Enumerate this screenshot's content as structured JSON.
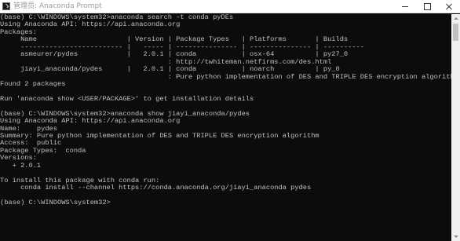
{
  "window": {
    "title": "管理员: Anaconda Prompt",
    "controls": {
      "minimize": "minimize",
      "maximize": "maximize",
      "close": "close"
    }
  },
  "console": {
    "lines": [
      "(base) C:\\WINDOWS\\system32>anaconda search -t conda pyDEs",
      "Using Anaconda API: https://api.anaconda.org",
      "Packages:",
      "     Name                      | Version | Package Types   | Platforms       | Builds",
      "     ------------------------- |   ----- | --------------- | --------------- | ----------",
      "     asmeurer/pydes            |   2.0.1 | conda           | osx-64          | py27_0",
      "                                         : http://twhiteman.netfirms.com/des.html",
      "     jiayi_anaconda/pydes      |   2.0.1 | conda           | noarch          | py_0",
      "                                         : Pure python implementation of DES and TRIPLE DES encryption algorithm",
      "Found 2 packages",
      "",
      "Run 'anaconda show <USER/PACKAGE>' to get installation details",
      "",
      "(base) C:\\WINDOWS\\system32>anaconda show jiayi_anaconda/pydes",
      "Using Anaconda API: https://api.anaconda.org",
      "Name:    pydes",
      "Summary: Pure python implementation of DES and TRIPLE DES encryption algorithm",
      "Access:  public",
      "Package Types:  conda",
      "Versions:",
      "   + 2.0.1",
      "",
      "To install this package with conda run:",
      "     conda install --channel https://conda.anaconda.org/jiayi_anaconda pydes",
      "",
      "(base) C:\\WINDOWS\\system32>"
    ]
  },
  "colors": {
    "console_bg": "#0c0c0c",
    "console_text": "#c0c0c0",
    "titlebar_bg": "#ffffff",
    "scrollbar_bg": "#f0f0f0"
  }
}
